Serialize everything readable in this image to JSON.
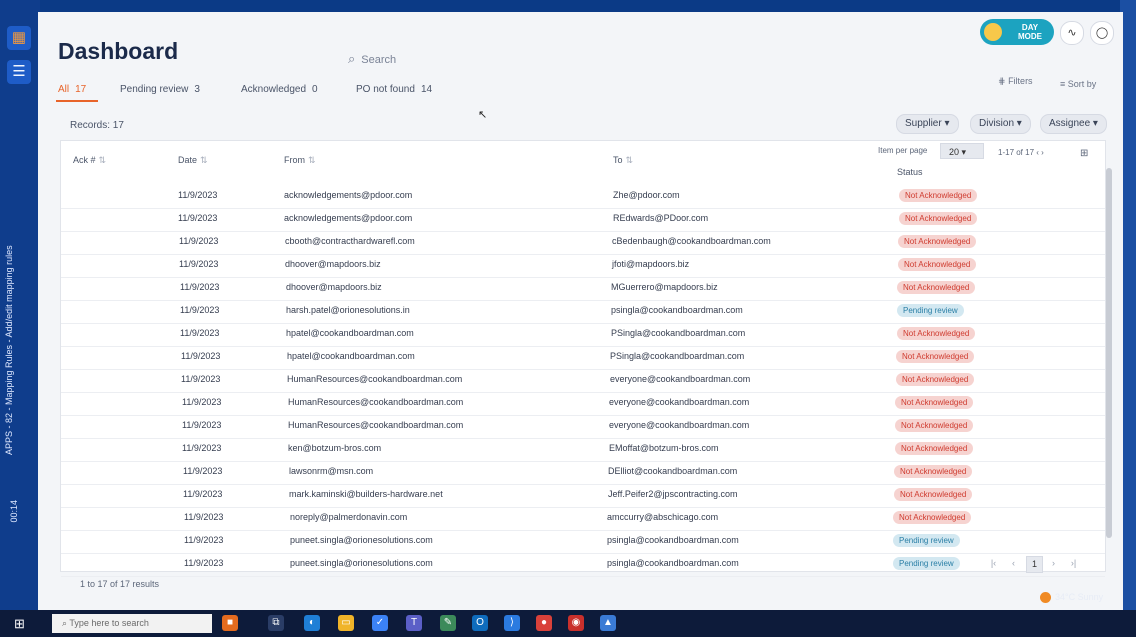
{
  "app": {
    "title": "Dashboard"
  },
  "header": {
    "search_placeholder": "Search",
    "day_mode_line1": "DAY",
    "day_mode_line2": "MODE",
    "filters_label": "Filters",
    "sort_label": "Sort by"
  },
  "tabs": [
    {
      "label": "All",
      "count": "17"
    },
    {
      "label": "Pending review",
      "count": "3"
    },
    {
      "label": "Acknowledged",
      "count": "0"
    },
    {
      "label": "PO not found",
      "count": "14"
    }
  ],
  "toolbar": {
    "records": "Records: 17",
    "supplier": "Supplier",
    "division": "Division",
    "assignee": "Assignee",
    "items_per_page_label": "Item per page",
    "items_per_page": "20",
    "range": "1-17 of 17"
  },
  "table": {
    "columns": [
      "Ack #",
      "Date",
      "From",
      "To",
      "Status"
    ],
    "rows": [
      {
        "date": "11/9/2023",
        "from": "acknowledgements@pdoor.com",
        "to": "Zhe@pdoor.com",
        "status": "Not Acknowledged"
      },
      {
        "date": "11/9/2023",
        "from": "acknowledgements@pdoor.com",
        "to": "REdwards@PDoor.com",
        "status": "Not Acknowledged"
      },
      {
        "date": "11/9/2023",
        "from": "cbooth@contracthardwarefl.com",
        "to": "cBedenbaugh@cookandboardman.com",
        "status": "Not Acknowledged"
      },
      {
        "date": "11/9/2023",
        "from": "dhoover@mapdoors.biz",
        "to": "jfoti@mapdoors.biz",
        "status": "Not Acknowledged"
      },
      {
        "date": "11/9/2023",
        "from": "dhoover@mapdoors.biz",
        "to": "MGuerrero@mapdoors.biz",
        "status": "Not Acknowledged"
      },
      {
        "date": "11/9/2023",
        "from": "harsh.patel@orionesolutions.in",
        "to": "psingla@cookandboardman.com",
        "status": "Pending review"
      },
      {
        "date": "11/9/2023",
        "from": "hpatel@cookandboardman.com",
        "to": "PSingla@cookandboardman.com",
        "status": "Not Acknowledged"
      },
      {
        "date": "11/9/2023",
        "from": "hpatel@cookandboardman.com",
        "to": "PSingla@cookandboardman.com",
        "status": "Not Acknowledged"
      },
      {
        "date": "11/9/2023",
        "from": "HumanResources@cookandboardman.com",
        "to": "everyone@cookandboardman.com",
        "status": "Not Acknowledged"
      },
      {
        "date": "11/9/2023",
        "from": "HumanResources@cookandboardman.com",
        "to": "everyone@cookandboardman.com",
        "status": "Not Acknowledged"
      },
      {
        "date": "11/9/2023",
        "from": "HumanResources@cookandboardman.com",
        "to": "everyone@cookandboardman.com",
        "status": "Not Acknowledged"
      },
      {
        "date": "11/9/2023",
        "from": "ken@botzum-bros.com",
        "to": "EMoffat@botzum-bros.com",
        "status": "Not Acknowledged"
      },
      {
        "date": "11/9/2023",
        "from": "lawsonrm@msn.com",
        "to": "DElliot@cookandboardman.com",
        "status": "Not Acknowledged"
      },
      {
        "date": "11/9/2023",
        "from": "mark.kaminski@builders-hardware.net",
        "to": "Jeff.Peifer2@jpscontracting.com",
        "status": "Not Acknowledged"
      },
      {
        "date": "11/9/2023",
        "from": "noreply@palmerdonavin.com",
        "to": "amccurry@abschicago.com",
        "status": "Not Acknowledged"
      },
      {
        "date": "11/9/2023",
        "from": "puneet.singla@orionesolutions.com",
        "to": "psingla@cookandboardman.com",
        "status": "Pending review"
      },
      {
        "date": "11/9/2023",
        "from": "puneet.singla@orionesolutions.com",
        "to": "psingla@cookandboardman.com",
        "status": "Pending review"
      }
    ]
  },
  "footer": {
    "results": "1 to 17 of 17 results",
    "current_page": "1"
  },
  "os": {
    "sidebar_text": "APPS - 82 - Mapping Rules - Add/edit mapping rules",
    "timer": "00:14",
    "taskbar_search": "Type here to search",
    "weather": "34°C Sunny"
  },
  "colors": {
    "accent": "#e8642a",
    "not_ack_bg": "#f6d3d0",
    "not_ack_fg": "#cf3b2f",
    "pending_bg": "#d3e8f1",
    "pending_fg": "#2a7fa6"
  },
  "icons": [
    "grid-icon",
    "checklist-icon",
    "search-icon",
    "sun-icon",
    "activity-icon",
    "user-icon",
    "filter-icon",
    "sort-icon",
    "chevron-down-icon",
    "sort-arrows-icon",
    "columns-icon",
    "windows-icon"
  ]
}
